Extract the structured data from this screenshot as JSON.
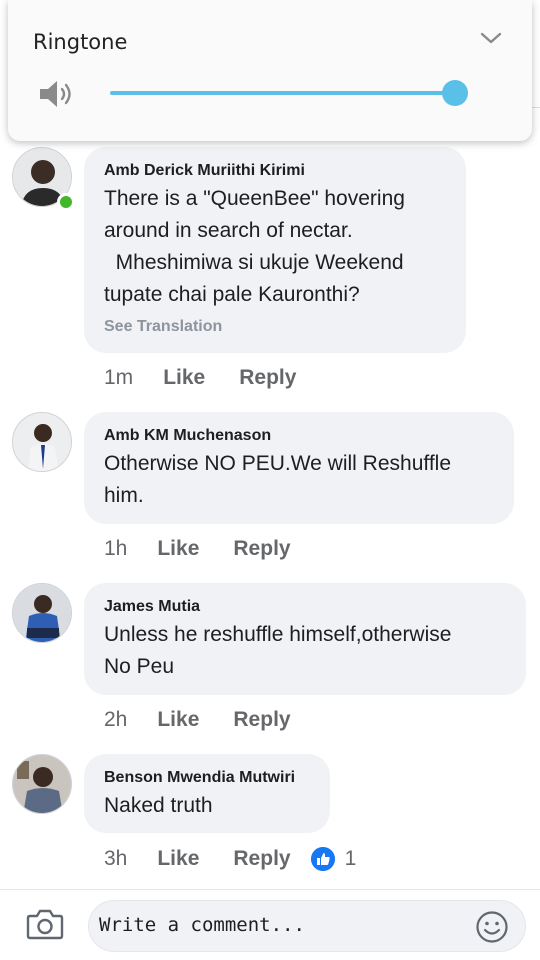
{
  "volume": {
    "title": "Ringtone",
    "level": 0.96,
    "accent": "#5bc0e8",
    "icon": "speaker-icon",
    "collapse_icon": "chevron-down-icon"
  },
  "comments": [
    {
      "author": "Amb Derick Muriithi Kirimi",
      "text": "There is a \"QueenBee\" hovering\naround in search of nectar.\n  Mheshimiwa si ukuje Weekend\ntupate chai pale Kauronthi?",
      "translation": "See Translation",
      "time": "1m",
      "like": "Like",
      "reply": "Reply",
      "online": true
    },
    {
      "author": "Amb KM Muchenason",
      "text": "Otherwise NO PEU.We will Reshuffle\nhim.",
      "time": "1h",
      "like": "Like",
      "reply": "Reply"
    },
    {
      "author": "James Mutia",
      "text": "Unless he reshuffle himself,otherwise\nNo Peu",
      "time": "2h",
      "like": "Like",
      "reply": "Reply"
    },
    {
      "author": "Benson Mwendia Mutwiri",
      "text": "Naked truth",
      "time": "3h",
      "like": "Like",
      "reply": "Reply",
      "reaction_count": "1"
    }
  ],
  "composer": {
    "placeholder": "Write a comment...",
    "camera_icon": "camera-icon",
    "emoji_icon": "smiley-icon"
  },
  "colors": {
    "bubble": "#f0f2f5",
    "meta": "#65676b",
    "like_blue": "#1877f2",
    "online_green": "#42b72a"
  }
}
